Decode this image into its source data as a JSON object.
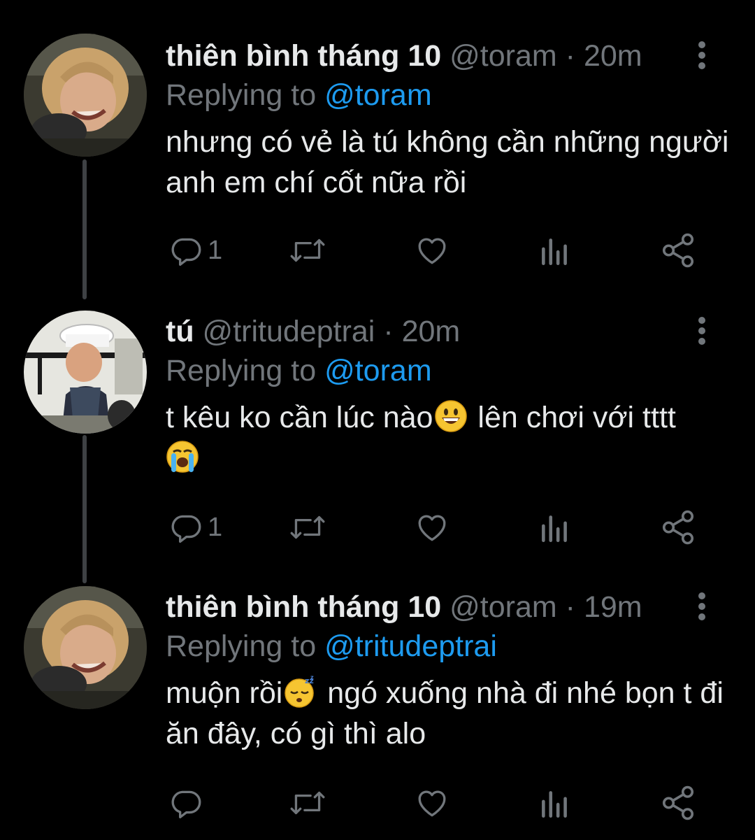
{
  "tweets": [
    {
      "name": "thiên bình tháng 10",
      "handle": "@toram",
      "dot": "·",
      "time": "20m",
      "replying_prefix": "Replying to ",
      "replying_to": "@toram",
      "text_parts": [
        "nhưng có vẻ là tú không cần những người anh em chí cốt nữa rồi"
      ],
      "reply_count": "1"
    },
    {
      "name": "tú",
      "handle": "@tritudeptrai",
      "dot": "·",
      "time": "20m",
      "replying_prefix": "Replying to ",
      "replying_to": "@toram",
      "text_parts": [
        "t kêu ko cần lúc nào",
        " lên chơi với tttt"
      ],
      "emojis": [
        "grinning-face",
        "loudly-crying-face"
      ],
      "reply_count": "1"
    },
    {
      "name": "thiên bình tháng 10",
      "handle": "@toram",
      "dot": "·",
      "time": "19m",
      "replying_prefix": "Replying to ",
      "replying_to": "@tritudeptrai",
      "text_parts": [
        "muộn rồi",
        " ngó xuống nhà đi nhé bọn t đi ăn đây, có gì thì alo"
      ],
      "emojis": [
        "sleeping-face"
      ],
      "reply_count": ""
    }
  ],
  "icons": [
    "reply-icon",
    "retweet-icon",
    "like-icon",
    "analytics-icon",
    "share-icon",
    "more-icon"
  ],
  "colors": {
    "background": "#000000",
    "text": "#e7e9ea",
    "secondary": "#71767b",
    "accent": "#1d9bf0",
    "thread_line": "#3e4144"
  }
}
